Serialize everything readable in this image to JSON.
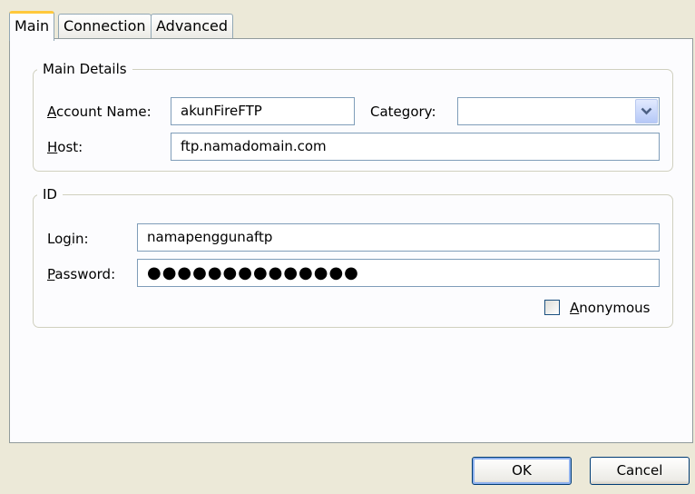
{
  "tabs": [
    {
      "label": "Main",
      "active": true
    },
    {
      "label": "Connection",
      "active": false
    },
    {
      "label": "Advanced",
      "active": false
    }
  ],
  "main_details": {
    "legend": "Main Details",
    "account_name_label": {
      "key": "A",
      "rest": "ccount Name:"
    },
    "account_name_value": "akunFireFTP",
    "category_label": {
      "pre": "Cate",
      "key": "g",
      "rest": "ory:"
    },
    "category_value": "",
    "host_label": {
      "key": "H",
      "rest": "ost:"
    },
    "host_value": "ftp.namadomain.com"
  },
  "id_group": {
    "legend": "ID",
    "login_label": {
      "pre": "Lo",
      "key": "g",
      "rest": "in:"
    },
    "login_value": "namapenggunaftp",
    "password_label": {
      "key": "P",
      "rest": "assword:"
    },
    "password_value": "●●●●●●●●●●●●●●",
    "anonymous_label": {
      "key": "A",
      "rest": "nonymous"
    },
    "anonymous_checked": false
  },
  "buttons": {
    "ok": "OK",
    "cancel": "Cancel"
  },
  "icons": {
    "dropdown": "chevron-down-icon"
  }
}
